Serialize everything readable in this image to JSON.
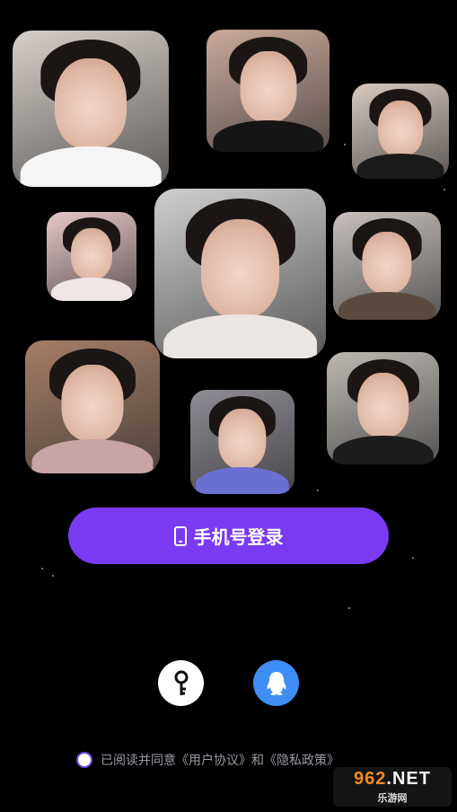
{
  "photos": [
    {
      "name": "avatar-photo-1",
      "bg": "#d7cfc9",
      "shirt": "#f5f5f5"
    },
    {
      "name": "avatar-photo-2",
      "bg": "#caa99b",
      "shirt": "#151515"
    },
    {
      "name": "avatar-photo-3",
      "bg": "#d7c9c0",
      "shirt": "#1a1a1a"
    },
    {
      "name": "avatar-photo-4",
      "bg": "#e8c7c9",
      "shirt": "#f0e6e6"
    },
    {
      "name": "avatar-photo-5",
      "bg": "#cfcfcf",
      "shirt": "#ece6e2"
    },
    {
      "name": "avatar-photo-6",
      "bg": "#c8c1bd",
      "shirt": "#5a4a3e"
    },
    {
      "name": "avatar-photo-7",
      "bg": "#a67e66",
      "shirt": "#c9a4a7"
    },
    {
      "name": "avatar-photo-8",
      "bg": "#8f8c95",
      "shirt": "#6a6fd0"
    },
    {
      "name": "avatar-photo-9",
      "bg": "#bdb8b2",
      "shirt": "#1c1c1c"
    }
  ],
  "login": {
    "phone_label": "手机号登录"
  },
  "alt_login": {
    "key_icon": "key-icon",
    "qq_icon": "qq-icon"
  },
  "agreement": {
    "text": "已阅读并同意《用户协议》和《隐私政策》"
  },
  "watermark": {
    "number": "962",
    "suffix": ".NET",
    "subtitle": "乐游网"
  },
  "colors": {
    "background": "#000000",
    "primary": "#7a3af2",
    "qq": "#3f8ef5"
  }
}
